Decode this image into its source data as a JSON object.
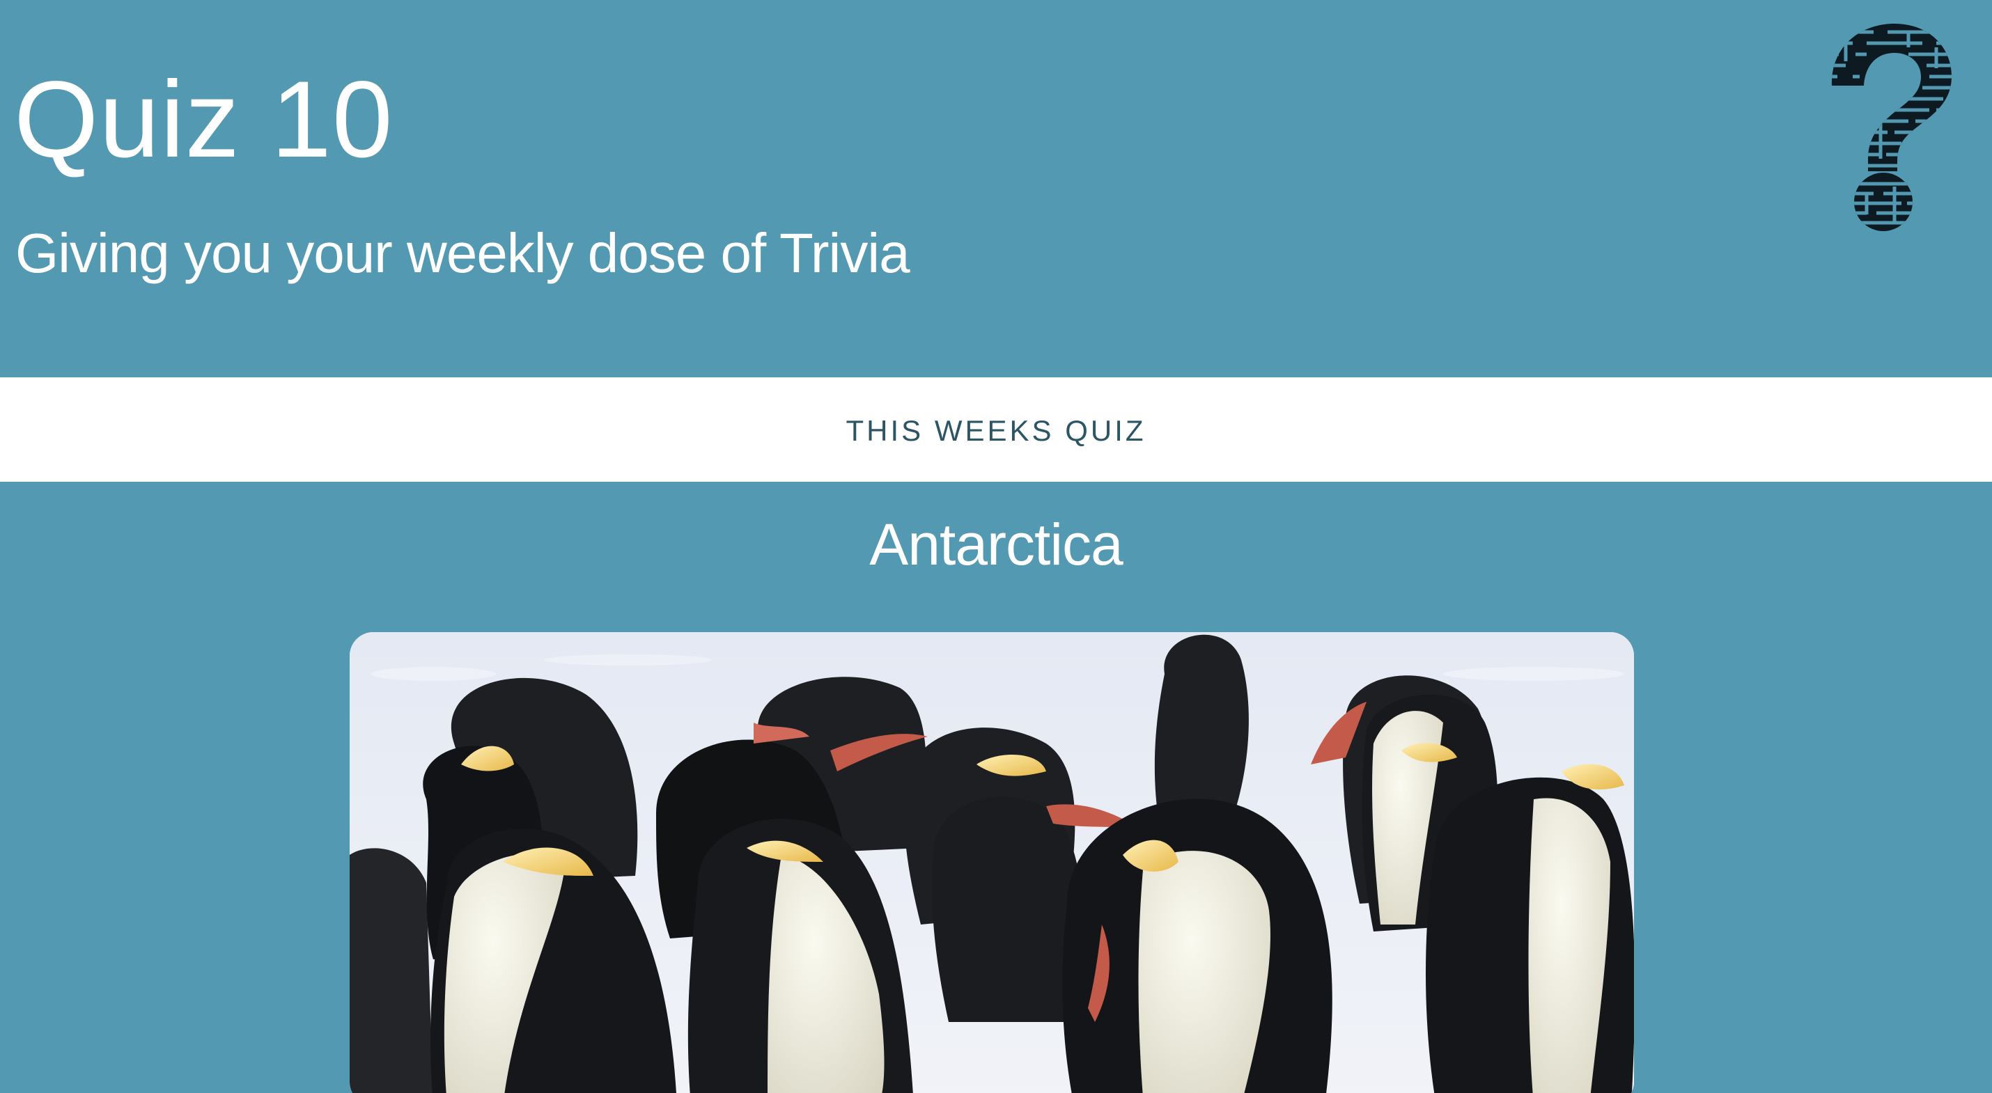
{
  "header": {
    "title": "Quiz 10",
    "subtitle": "Giving you your weekly dose of Trivia",
    "logo_icon": "question-mark-maze-icon"
  },
  "nav": {
    "link_label": "THIS WEEKS QUIZ"
  },
  "main": {
    "quiz_title": "Antarctica",
    "image_subject": "emperor-penguins-photo"
  },
  "colors": {
    "background": "#5399b2",
    "nav_background": "#ffffff",
    "nav_text": "#2c5566",
    "heading_text": "#ffffff"
  }
}
